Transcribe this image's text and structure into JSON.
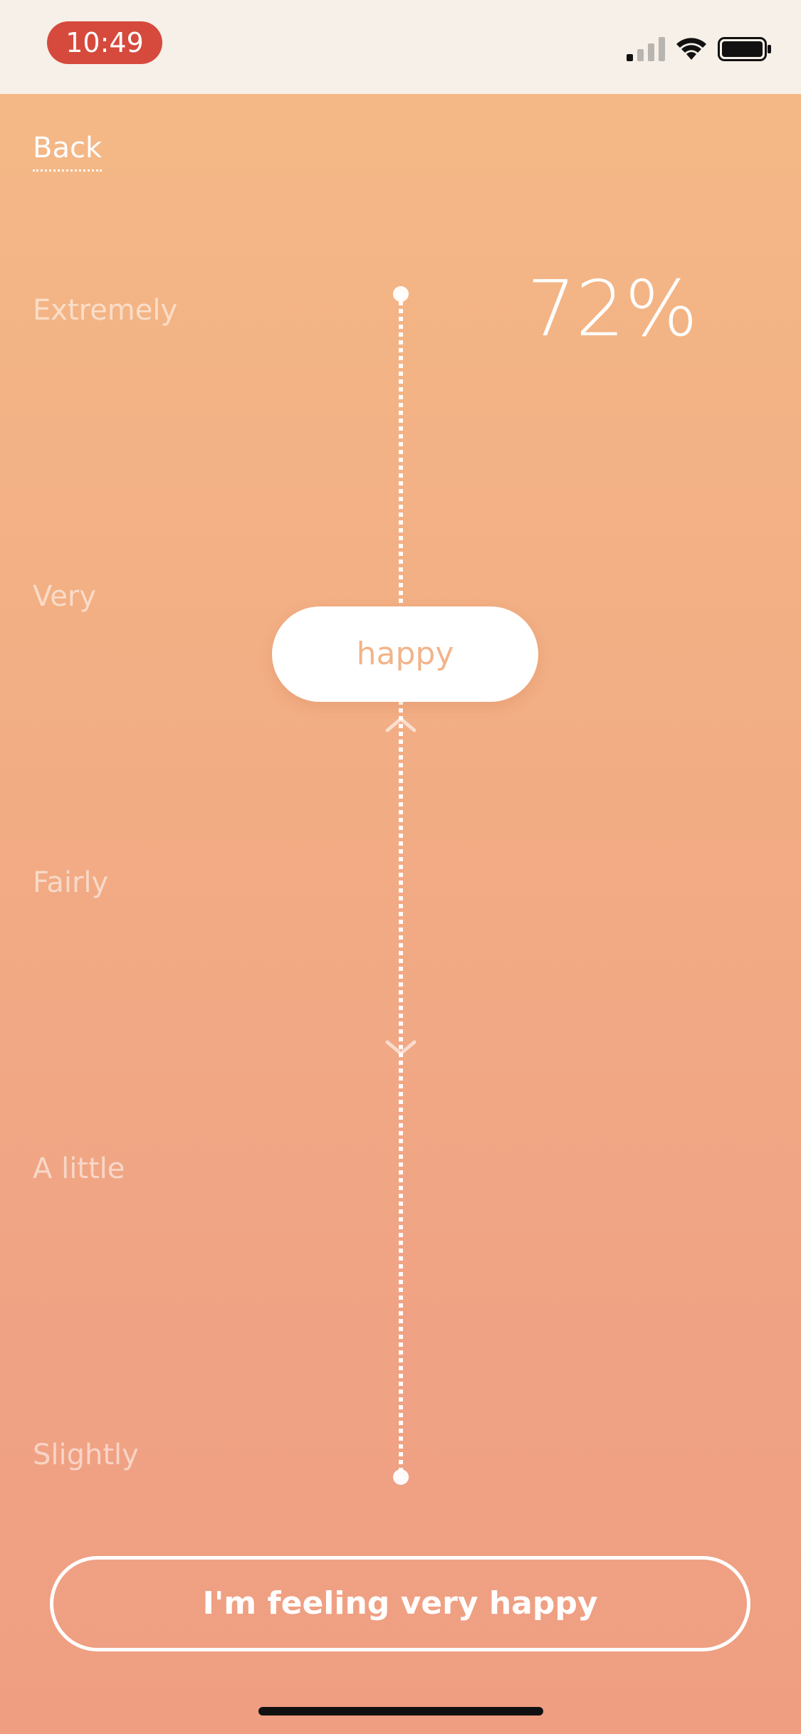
{
  "status_bar": {
    "time": "10:49",
    "time_pill_color": "#d54a3d",
    "icons": [
      "cellular-signal-icon",
      "wifi-icon",
      "battery-icon"
    ]
  },
  "nav": {
    "back_label": "Back"
  },
  "scale": {
    "levels": [
      "Extremely",
      "Very",
      "Fairly",
      "A little",
      "Slightly"
    ],
    "percent_text": "72%",
    "value": 0.72,
    "handle_label": "happy"
  },
  "cta": {
    "label": "I'm feeling very happy"
  },
  "colors": {
    "gradient_top": "#f4b886",
    "gradient_bottom": "#ef9e82",
    "accent_text": "#f2b48a"
  }
}
